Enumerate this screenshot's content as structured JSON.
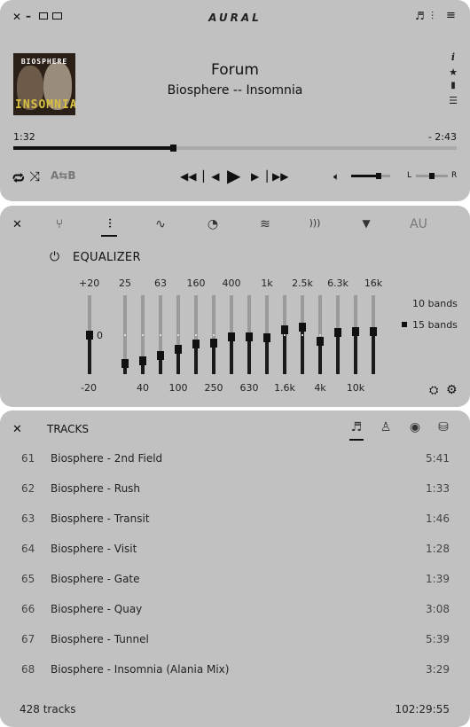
{
  "app": {
    "title": "AURAL"
  },
  "player": {
    "window_controls": {
      "close": "✕",
      "minimize": "–"
    },
    "top_right_icons": [
      "playlist-icon",
      "equalizer-icon",
      "menu-icon"
    ],
    "album_art": {
      "top_text": "BIOSPHERE",
      "bottom_text": "INSOMNIA"
    },
    "track_title": "Forum",
    "track_artist_album": "Biosphere -- Insomnia",
    "side_icons": [
      "info-icon",
      "star-icon",
      "bookmark-icon",
      "list-icon"
    ],
    "elapsed": "1:32",
    "remaining": "- 2:43",
    "progress": 0.36,
    "repeat_label": "⇄",
    "ab_loop_label": "A⇆B",
    "volume": 0.7,
    "balance": 0.5,
    "balance_left": "L",
    "balance_right": "R"
  },
  "effects": {
    "tabs": [
      {
        "icon": "branch-icon",
        "glyph": "⑂"
      },
      {
        "icon": "equalizer-sliders-icon",
        "glyph": "⫶"
      },
      {
        "icon": "waveform-icon",
        "glyph": "∿"
      },
      {
        "icon": "gauge-icon",
        "glyph": "◔"
      },
      {
        "icon": "reverb-icon",
        "glyph": "≋"
      },
      {
        "icon": "delay-icon",
        "glyph": ")))"
      },
      {
        "icon": "filter-icon",
        "glyph": "▼"
      },
      {
        "icon": "au-plugin-icon",
        "glyph": "AU"
      }
    ],
    "active_tab": 1,
    "equalizer": {
      "title": "EQUALIZER",
      "db_top": "+20",
      "db_mid": "0",
      "db_bottom": "-20",
      "top_freq_labels": [
        "25",
        "63",
        "160",
        "400",
        "1k",
        "2.5k",
        "6.3k",
        "16k"
      ],
      "bottom_freq_labels": [
        "40",
        "100",
        "250",
        "630",
        "1.6k",
        "4k",
        "10k"
      ],
      "preamp": 0.5,
      "bands": [
        0.13,
        0.17,
        0.24,
        0.32,
        0.38,
        0.39,
        0.47,
        0.47,
        0.46,
        0.56,
        0.6,
        0.42,
        0.53,
        0.54,
        0.54
      ],
      "band_options": [
        "10 bands",
        "15 bands"
      ],
      "selected_band_option": "15 bands",
      "bottom_icons": [
        "presets-icon",
        "settings-icon"
      ]
    }
  },
  "tracks": {
    "title": "TRACKS",
    "view_icons": [
      "tracks-view-icon",
      "artists-view-icon",
      "albums-view-icon",
      "genres-view-icon"
    ],
    "rows": [
      {
        "num": "61",
        "title": "Biosphere - 2nd Field",
        "duration": "5:41"
      },
      {
        "num": "62",
        "title": "Biosphere - Rush",
        "duration": "1:33"
      },
      {
        "num": "63",
        "title": "Biosphere - Transit",
        "duration": "1:46"
      },
      {
        "num": "64",
        "title": "Biosphere - Visit",
        "duration": "1:28"
      },
      {
        "num": "65",
        "title": "Biosphere - Gate",
        "duration": "1:39"
      },
      {
        "num": "66",
        "title": "Biosphere - Quay",
        "duration": "3:08"
      },
      {
        "num": "67",
        "title": "Biosphere - Tunnel",
        "duration": "5:39"
      },
      {
        "num": "68",
        "title": "Biosphere - Insomnia (Alania Mix)",
        "duration": "3:29"
      }
    ],
    "track_count": "428 tracks",
    "total_duration": "102:29:55"
  }
}
